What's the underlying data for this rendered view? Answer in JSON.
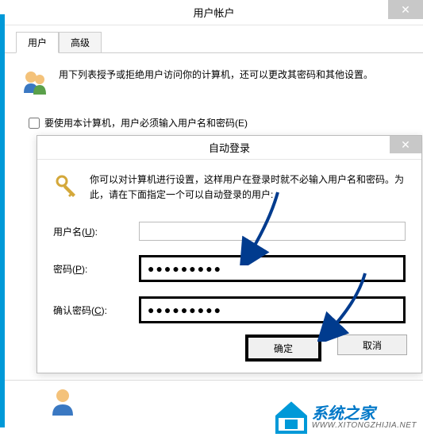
{
  "parent": {
    "title": "用户帐户",
    "tabs": {
      "users": "用户",
      "advanced": "高级"
    },
    "intro": "用下列表授予或拒绝用户访问你的计算机，还可以更改其密码和其他设置。",
    "checkbox_label": "要使用本计算机，用户必须输入用户名和密码(E)"
  },
  "child": {
    "title": "自动登录",
    "intro": "你可以对计算机进行设置，这样用户在登录时就不必输入用户名和密码。为此，请在下面指定一个可以自动登录的用户:",
    "labels": {
      "username_pre": "用户名(",
      "username_u": "U",
      "username_post": "):",
      "password_pre": "密码(",
      "password_u": "P",
      "password_post": "):",
      "confirm_pre": "确认密码(",
      "confirm_u": "C",
      "confirm_post": "):"
    },
    "values": {
      "username": "",
      "password": "●●●●●●●●●",
      "confirm": "●●●●●●●●●"
    },
    "buttons": {
      "ok": "确定",
      "cancel": "取消"
    }
  },
  "branding": {
    "cn": "系统之家",
    "url": "WWW.XITONGZHIJIA.NET"
  }
}
